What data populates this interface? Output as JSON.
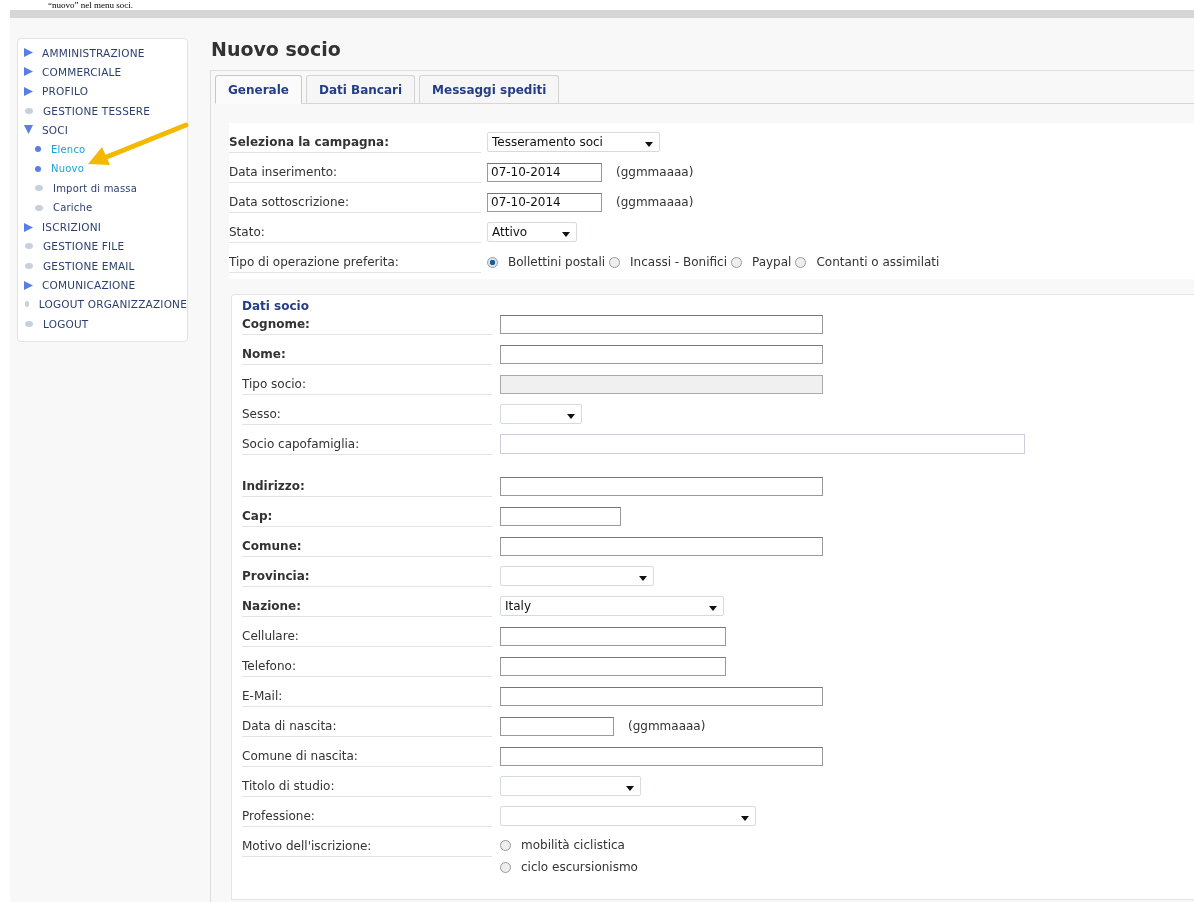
{
  "document_caption": "“nuovo” nel menu soci.",
  "sidebar": {
    "items": [
      {
        "label": "AMMINISTRAZIONE",
        "kind": "arrow",
        "expanded": false
      },
      {
        "label": "COMMERCIALE",
        "kind": "arrow",
        "expanded": false
      },
      {
        "label": "PROFILO",
        "kind": "arrow",
        "expanded": false
      },
      {
        "label": "GESTIONE TESSERE",
        "kind": "dot"
      },
      {
        "label": "SOCI",
        "kind": "arrow",
        "expanded": true,
        "children": [
          {
            "label": "Elenco",
            "active": true
          },
          {
            "label": "Nuovo",
            "active": true
          },
          {
            "label": "Import di massa",
            "active": false
          },
          {
            "label": "Cariche",
            "active": false
          }
        ]
      },
      {
        "label": "ISCRIZIONI",
        "kind": "arrow",
        "expanded": false
      },
      {
        "label": "GESTIONE FILE",
        "kind": "dot"
      },
      {
        "label": "GESTIONE EMAIL",
        "kind": "dot"
      },
      {
        "label": "COMUNICAZIONE",
        "kind": "arrow",
        "expanded": false
      },
      {
        "label": "LOGOUT ORGANIZZAZIONE",
        "kind": "dot"
      },
      {
        "label": "LOGOUT",
        "kind": "dot"
      }
    ]
  },
  "page_title": "Nuovo socio",
  "tabs": [
    {
      "label": "Generale",
      "selected": true
    },
    {
      "label": "Dati Bancari",
      "selected": false
    },
    {
      "label": "Messaggi spediti",
      "selected": false
    }
  ],
  "general_fields": [
    {
      "label": "Seleziona la campagna:",
      "bold": true,
      "kind": "select",
      "value": "Tesseramento soci"
    },
    {
      "label": "Data inserimento:",
      "bold": false,
      "kind": "text",
      "value": "07-10-2014",
      "hint": "(ggmmaaaa)"
    },
    {
      "label": "Data sottoscrizione:",
      "bold": false,
      "kind": "text",
      "value": "07-10-2014",
      "hint": "(ggmmaaaa)"
    },
    {
      "label": "Stato:",
      "bold": false,
      "kind": "select",
      "value": "Attivo"
    },
    {
      "label": "Tipo di operazione preferita:",
      "bold": false,
      "kind": "radios",
      "options": [
        {
          "label": "Bollettini postali",
          "selected": true
        },
        {
          "label": "Incassi - Bonifici",
          "selected": false
        },
        {
          "label": "Paypal",
          "selected": false
        },
        {
          "label": "Contanti o assimilati",
          "selected": false
        }
      ]
    }
  ],
  "member_section": {
    "title": "Dati socio",
    "fields": [
      {
        "label": "Cognome:",
        "bold": true,
        "kind": "text"
      },
      {
        "label": "Nome:",
        "bold": true,
        "kind": "text"
      },
      {
        "label": "Tipo socio:",
        "bold": false,
        "kind": "text",
        "disabled": true
      },
      {
        "label": "Sesso:",
        "bold": false,
        "kind": "select"
      },
      {
        "label": "Socio capofamiglia:",
        "bold": false,
        "kind": "lookup"
      },
      {
        "label": "Indirizzo:",
        "bold": true,
        "kind": "text"
      },
      {
        "label": "Cap:",
        "bold": true,
        "kind": "text"
      },
      {
        "label": "Comune:",
        "bold": true,
        "kind": "text"
      },
      {
        "label": "Provincia:",
        "bold": true,
        "kind": "select"
      },
      {
        "label": "Nazione:",
        "bold": true,
        "kind": "select",
        "value": "Italy"
      },
      {
        "label": "Cellulare:",
        "bold": false,
        "kind": "text"
      },
      {
        "label": "Telefono:",
        "bold": false,
        "kind": "text"
      },
      {
        "label": "E-Mail:",
        "bold": false,
        "kind": "text"
      },
      {
        "label": "Data di nascita:",
        "bold": false,
        "kind": "text",
        "hint": "(ggmmaaaa)"
      },
      {
        "label": "Comune di nascita:",
        "bold": false,
        "kind": "text"
      },
      {
        "label": "Titolo di studio:",
        "bold": false,
        "kind": "select"
      },
      {
        "label": "Professione:",
        "bold": false,
        "kind": "select"
      },
      {
        "label": "Motivo dell'iscrizione:",
        "bold": false,
        "kind": "radio_list",
        "options": [
          {
            "label": "mobilità ciclistica",
            "selected": false
          },
          {
            "label": "ciclo escursionismo",
            "selected": false
          }
        ]
      }
    ]
  }
}
